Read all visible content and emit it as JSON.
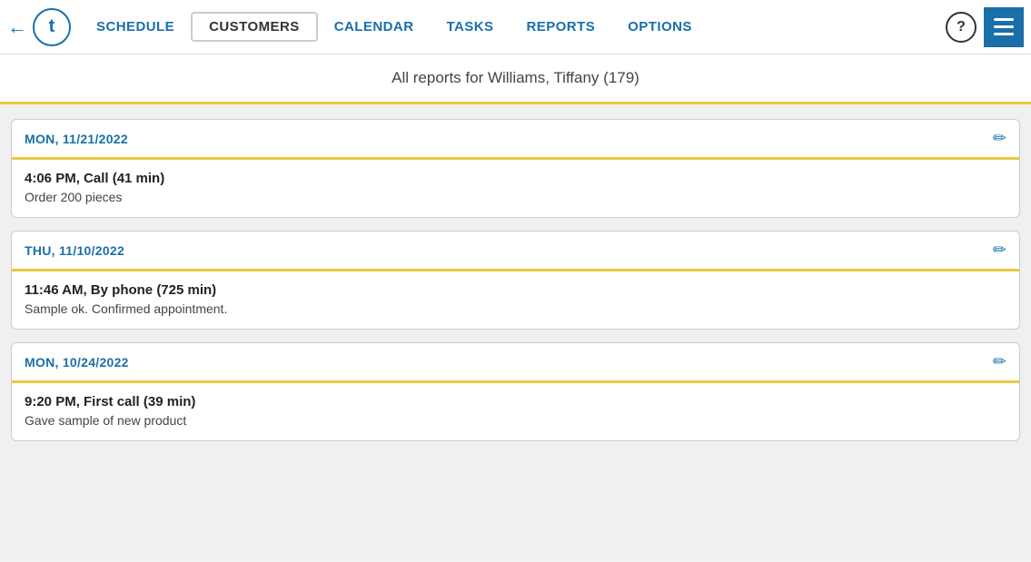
{
  "nav": {
    "back_icon": "←",
    "logo_letter": "t",
    "items": [
      {
        "label": "SCHEDULE",
        "active": false
      },
      {
        "label": "CUSTOMERS",
        "active": true
      },
      {
        "label": "CALENDAR",
        "active": false
      },
      {
        "label": "TASKS",
        "active": false
      },
      {
        "label": "REPORTS",
        "active": false
      },
      {
        "label": "OPTIONS",
        "active": false
      }
    ],
    "help_label": "?",
    "menu_icon": "menu"
  },
  "page_title": "All reports for Williams, Tiffany (179)",
  "reports": [
    {
      "date": "MON, 11/21/2022",
      "time_type": "4:06 PM, Call (41 min)",
      "notes": "Order 200 pieces"
    },
    {
      "date": "THU, 11/10/2022",
      "time_type": "11:46 AM, By phone (725 min)",
      "notes": "Sample ok. Confirmed appointment."
    },
    {
      "date": "MON, 10/24/2022",
      "time_type": "9:20 PM, First call (39 min)",
      "notes": "Gave sample of new product"
    }
  ],
  "colors": {
    "accent_blue": "#1a6fa8",
    "accent_gold": "#e8c840"
  }
}
